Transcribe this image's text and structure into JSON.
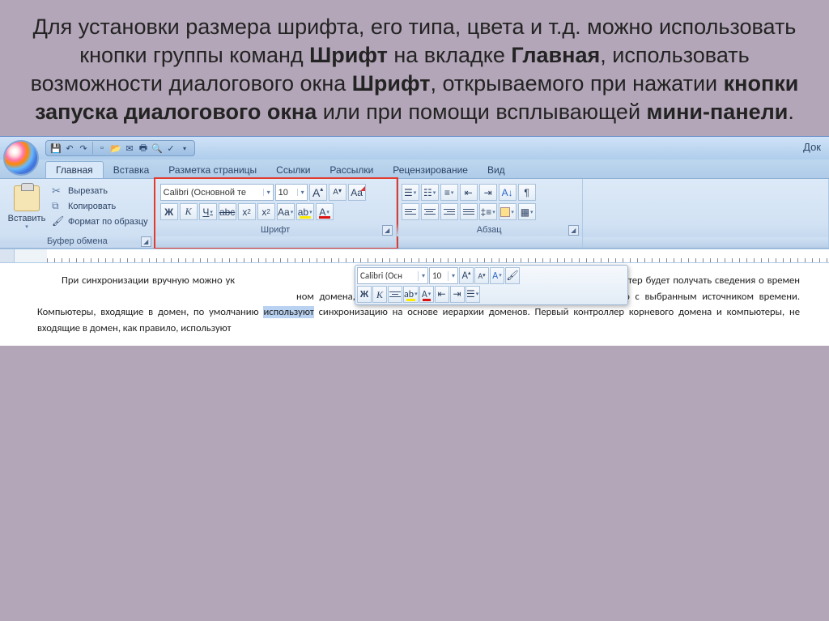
{
  "slide": {
    "text_html": "Для установки размера шрифта, его типа, цвета и т.д. можно использовать кнопки группы команд <b>Шрифт</b> на вкладке <b>Главная</b>, использовать возможности диалогового окна <b>Шрифт</b>, открываемого при нажатии <b>кнопки запуска диалогового окна</b> или при помощи всплывающей <b>мини-панели</b>."
  },
  "titlebar": {
    "doc_title_partial": "Док"
  },
  "tabs": {
    "t1": "Главная",
    "t2": "Вставка",
    "t3": "Разметка страницы",
    "t4": "Ссылки",
    "t5": "Рассылки",
    "t6": "Рецензирование",
    "t7": "Вид"
  },
  "clipboard": {
    "paste": "Вставить",
    "cut": "Вырезать",
    "copy": "Копировать",
    "format_painter": "Формат по образцу",
    "group_label": "Буфер обмена"
  },
  "font": {
    "family": "Calibri (Основной те",
    "size": "10",
    "bold": "Ж",
    "italic": "К",
    "underline": "Ч",
    "strike": "abc",
    "sub": "x₂",
    "sup": "x²",
    "case": "Aa",
    "clear_fmt_icon": "Aa",
    "grow": "A",
    "shrink": "A",
    "highlight": "ab",
    "color": "A",
    "group_label": "Шрифт"
  },
  "paragraph": {
    "group_label": "Абзац"
  },
  "mini": {
    "family": "Calibri (Осн",
    "size": "10"
  },
  "doc": {
    "p1a": "При синхронизации вручную можно ук",
    "p1b": "х узлов, с которых компьютер будет получать сведения о времен",
    "p1c": "ном домена, то его необходимо вручную настроить на синхронизацию с выбранным источником времени. Компьютеры, входящие в домен, по умолчанию ",
    "sel": "используют",
    "p1d": " синхронизацию на основе иерархии доменов. Первый контроллер корневого домена и компьютеры, не входящие в домен, как правило, используют"
  }
}
